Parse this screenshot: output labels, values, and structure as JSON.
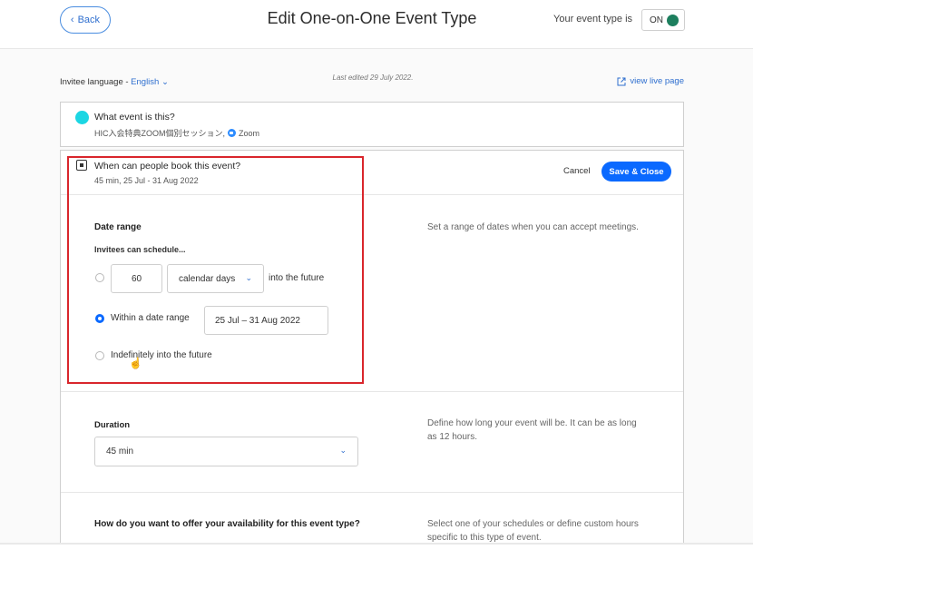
{
  "header": {
    "back_label": "Back",
    "title": "Edit One-on-One Event Type",
    "status_label": "Your event type is",
    "toggle_label": "ON"
  },
  "meta": {
    "language_prefix": "Invitee language - ",
    "language_value": "English",
    "last_edited": "Last edited 29 July 2022.",
    "view_live_label": "view live page"
  },
  "event_card": {
    "question": "What event is this?",
    "subtitle": "HIC入会特典ZOOM個別セッション,",
    "location": "Zoom"
  },
  "booking_card": {
    "question": "When can people book this event?",
    "subtitle": "45 min, 25 Jul - 31 Aug 2022",
    "cancel_label": "Cancel",
    "save_label": "Save & Close"
  },
  "date_range": {
    "title": "Date range",
    "subtitle": "Invitees can schedule...",
    "help": "Set a range of dates when you can accept meetings.",
    "option_days_value": "60",
    "option_days_unit": "calendar days",
    "option_days_suffix": "into the future",
    "option_range_label": "Within a date range",
    "option_range_value": "25 Jul – 31 Aug 2022",
    "option_indefinite_label": "Indefinitely into the future",
    "selected_option": "Within a date range"
  },
  "duration": {
    "title": "Duration",
    "value": "45 min",
    "help": "Define how long your event will be. It can be as long as 12 hours."
  },
  "availability": {
    "title": "How do you want to offer your availability for this event type?",
    "help": "Select one of your schedules or define custom hours specific to this type of event."
  },
  "colors": {
    "accent": "#0a69ff",
    "highlight": "#d9262c",
    "event_dot": "#1cd6e3",
    "toggle_knob": "#1d7f5e"
  }
}
